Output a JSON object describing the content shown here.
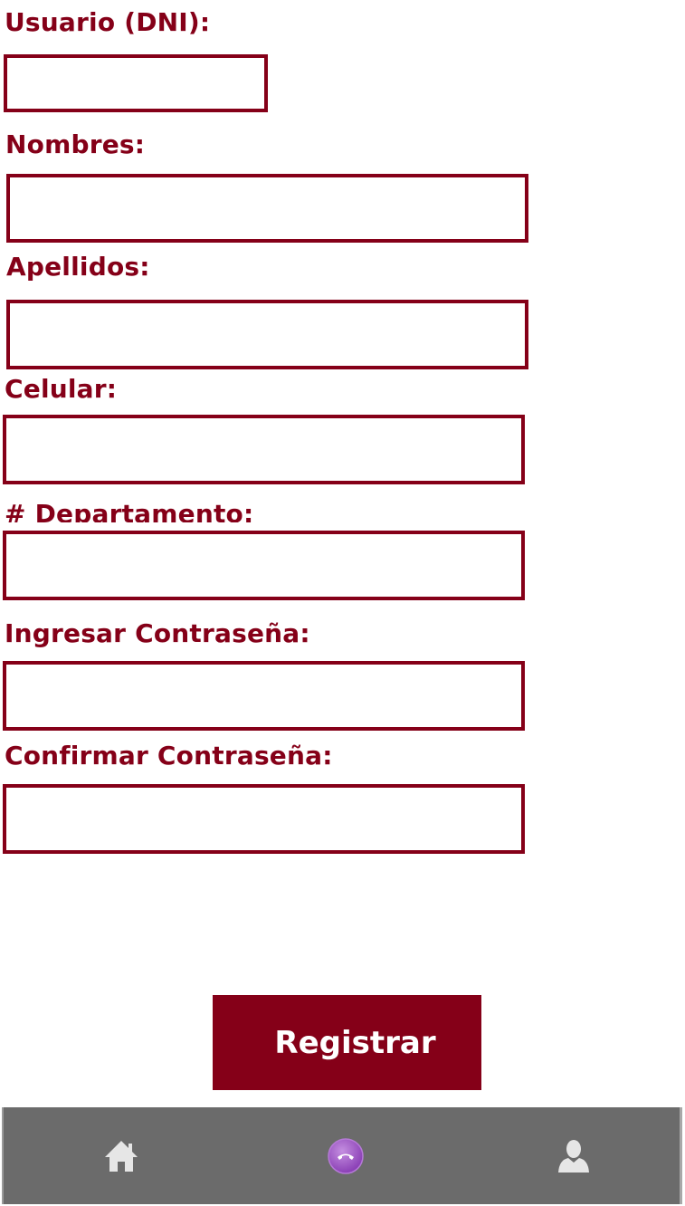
{
  "form": {
    "dni_label": "Usuario (DNI):",
    "nombres_label": "Nombres:",
    "apellidos_label": "Apellidos:",
    "celular_label": "Celular:",
    "departamento_label": "# Departamento:",
    "password_label": "Ingresar Contraseña:",
    "confirm_label": "Confirmar Contraseña:",
    "dni_value": "",
    "nombres_value": "",
    "apellidos_value": "",
    "celular_value": "",
    "departamento_value": "",
    "password_value": "",
    "confirm_value": ""
  },
  "actions": {
    "register_label": "Registrar"
  },
  "tabbar": {
    "items": [
      {
        "icon": "home-icon"
      },
      {
        "icon": "phone-icon"
      },
      {
        "icon": "user-icon"
      }
    ]
  },
  "colors": {
    "accent": "#850018",
    "tabbar_bg": "#6b6b6b",
    "phone_badge": "#9b4fc4"
  }
}
